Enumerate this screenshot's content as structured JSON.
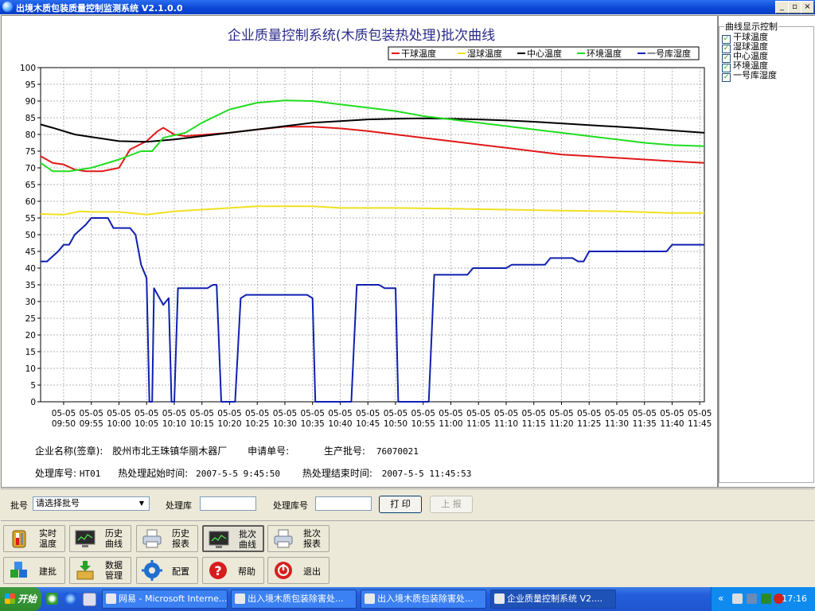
{
  "window": {
    "title": "出境木质包装质量控制监测系统 V2.1.0.0",
    "buttons": [
      "_",
      "▫",
      "×"
    ]
  },
  "chart_data": {
    "type": "line",
    "title": "企业质量控制系统(木质包装热处理)批次曲线",
    "ylim": [
      0,
      100
    ],
    "yticks": [
      0,
      5,
      10,
      15,
      20,
      25,
      30,
      35,
      40,
      45,
      50,
      55,
      60,
      65,
      70,
      75,
      80,
      85,
      90,
      95,
      100
    ],
    "xticks": [
      {
        "date": "05-05",
        "time": "09:50"
      },
      {
        "date": "05-05",
        "time": "09:55"
      },
      {
        "date": "05-05",
        "time": "10:00"
      },
      {
        "date": "05-05",
        "time": "10:05"
      },
      {
        "date": "05-05",
        "time": "10:10"
      },
      {
        "date": "05-05",
        "time": "10:15"
      },
      {
        "date": "05-05",
        "time": "10:20"
      },
      {
        "date": "05-05",
        "time": "10:25"
      },
      {
        "date": "05-05",
        "time": "10:30"
      },
      {
        "date": "05-05",
        "time": "10:35"
      },
      {
        "date": "05-05",
        "time": "10:40"
      },
      {
        "date": "05-05",
        "time": "10:45"
      },
      {
        "date": "05-05",
        "time": "10:50"
      },
      {
        "date": "05-05",
        "time": "10:55"
      },
      {
        "date": "05-05",
        "time": "11:00"
      },
      {
        "date": "05-05",
        "time": "11:05"
      },
      {
        "date": "05-05",
        "time": "11:10"
      },
      {
        "date": "05-05",
        "time": "11:15"
      },
      {
        "date": "05-05",
        "time": "11:20"
      },
      {
        "date": "05-05",
        "time": "11:25"
      },
      {
        "date": "05-05",
        "time": "11:30"
      },
      {
        "date": "05-05",
        "time": "11:35"
      },
      {
        "date": "05-05",
        "time": "11:40"
      },
      {
        "date": "05-05",
        "time": "11:45"
      }
    ],
    "x_range": [
      "09:45:50",
      "11:45:50"
    ],
    "grid": true,
    "legend_position": "top-right",
    "series": [
      {
        "name": "干球温度",
        "color": "#e01818",
        "points": [
          [
            "09:45:50",
            73.5
          ],
          [
            "09:48",
            71.5
          ],
          [
            "09:50",
            71
          ],
          [
            "09:52",
            69.5
          ],
          [
            "09:54",
            69
          ],
          [
            "09:57",
            69
          ],
          [
            "10:00",
            70
          ],
          [
            "10:02",
            75.5
          ],
          [
            "10:05",
            78
          ],
          [
            "10:07",
            81
          ],
          [
            "10:08",
            82
          ],
          [
            "10:10",
            80
          ],
          [
            "10:12",
            79.5
          ],
          [
            "10:20",
            80.5
          ],
          [
            "10:25",
            81.5
          ],
          [
            "10:30",
            82.3
          ],
          [
            "10:35",
            82.3
          ],
          [
            "10:40",
            81.8
          ],
          [
            "10:45",
            81
          ],
          [
            "10:50",
            80
          ],
          [
            "10:55",
            79
          ],
          [
            "11:00",
            78
          ],
          [
            "11:05",
            77
          ],
          [
            "11:10",
            76
          ],
          [
            "11:15",
            75
          ],
          [
            "11:20",
            74
          ],
          [
            "11:25",
            73.5
          ],
          [
            "11:30",
            73
          ],
          [
            "11:35",
            72.5
          ],
          [
            "11:40",
            72
          ],
          [
            "11:45:50",
            71.5
          ]
        ]
      },
      {
        "name": "湿球温度",
        "color": "#f0e020",
        "points": [
          [
            "09:45:50",
            56.2
          ],
          [
            "09:50",
            56
          ],
          [
            "09:53",
            57
          ],
          [
            "09:55",
            56.8
          ],
          [
            "10:00",
            56.8
          ],
          [
            "10:05",
            56
          ],
          [
            "10:10",
            57
          ],
          [
            "10:15",
            57.5
          ],
          [
            "10:20",
            58
          ],
          [
            "10:25",
            58.5
          ],
          [
            "10:30",
            58.5
          ],
          [
            "10:35",
            58.5
          ],
          [
            "10:40",
            58
          ],
          [
            "10:50",
            58
          ],
          [
            "11:00",
            57.8
          ],
          [
            "11:10",
            57.5
          ],
          [
            "11:20",
            57.2
          ],
          [
            "11:30",
            57
          ],
          [
            "11:40",
            56.5
          ],
          [
            "11:45:50",
            56.5
          ]
        ]
      },
      {
        "name": "中心温度",
        "color": "#000000",
        "points": [
          [
            "09:45:50",
            83
          ],
          [
            "09:48",
            82
          ],
          [
            "09:52",
            80
          ],
          [
            "09:56",
            79
          ],
          [
            "10:00",
            78
          ],
          [
            "10:05",
            77.8
          ],
          [
            "10:10",
            78.5
          ],
          [
            "10:15",
            79.5
          ],
          [
            "10:20",
            80.5
          ],
          [
            "10:25",
            81.5
          ],
          [
            "10:30",
            82.5
          ],
          [
            "10:35",
            83.5
          ],
          [
            "10:40",
            84
          ],
          [
            "10:45",
            84.5
          ],
          [
            "10:50",
            84.7
          ],
          [
            "10:55",
            84.8
          ],
          [
            "11:00",
            84.7
          ],
          [
            "11:05",
            84.5
          ],
          [
            "11:10",
            84.2
          ],
          [
            "11:15",
            83.8
          ],
          [
            "11:20",
            83.3
          ],
          [
            "11:25",
            82.8
          ],
          [
            "11:30",
            82.3
          ],
          [
            "11:35",
            81.8
          ],
          [
            "11:40",
            81.2
          ],
          [
            "11:45:50",
            80.5
          ]
        ]
      },
      {
        "name": "环境温度",
        "color": "#20dd20",
        "points": [
          [
            "09:45:50",
            71.5
          ],
          [
            "09:48",
            69
          ],
          [
            "09:51",
            69
          ],
          [
            "09:55",
            70
          ],
          [
            "10:00",
            72.5
          ],
          [
            "10:04",
            75
          ],
          [
            "10:06",
            75
          ],
          [
            "10:08",
            79
          ],
          [
            "10:12",
            80.5
          ],
          [
            "10:15",
            83.5
          ],
          [
            "10:20",
            87.5
          ],
          [
            "10:25",
            89.5
          ],
          [
            "10:30",
            90.2
          ],
          [
            "10:35",
            90
          ],
          [
            "10:40",
            89
          ],
          [
            "10:45",
            88
          ],
          [
            "10:50",
            87
          ],
          [
            "10:55",
            85.5
          ],
          [
            "11:00",
            84.5
          ],
          [
            "11:05",
            83.5
          ],
          [
            "11:10",
            82.5
          ],
          [
            "11:15",
            81.5
          ],
          [
            "11:20",
            80.5
          ],
          [
            "11:25",
            79.5
          ],
          [
            "11:30",
            78.5
          ],
          [
            "11:35",
            77.5
          ],
          [
            "11:40",
            76.8
          ],
          [
            "11:45:50",
            76.5
          ]
        ]
      },
      {
        "name": "一号库湿度",
        "color": "#1020b0",
        "points": [
          [
            "09:45:50",
            42
          ],
          [
            "09:47",
            42
          ],
          [
            "09:49",
            45
          ],
          [
            "09:50",
            47
          ],
          [
            "09:51",
            47
          ],
          [
            "09:52",
            50
          ],
          [
            "09:54",
            53
          ],
          [
            "09:55",
            55
          ],
          [
            "09:58",
            55
          ],
          [
            "09:59",
            52
          ],
          [
            "10:02",
            52
          ],
          [
            "10:03",
            50
          ],
          [
            "10:04",
            41
          ],
          [
            "10:05",
            37
          ],
          [
            "10:05:30",
            0
          ],
          [
            "10:06",
            0
          ],
          [
            "10:06:20",
            34
          ],
          [
            "10:07",
            32
          ],
          [
            "10:08",
            29
          ],
          [
            "10:09",
            31
          ],
          [
            "10:09:30",
            0
          ],
          [
            "10:10",
            0
          ],
          [
            "10:10:40",
            34
          ],
          [
            "10:16",
            34
          ],
          [
            "10:17",
            35
          ],
          [
            "10:17:40",
            35
          ],
          [
            "10:18:30",
            0
          ],
          [
            "10:21",
            0
          ],
          [
            "10:22",
            31
          ],
          [
            "10:23",
            32
          ],
          [
            "10:34",
            32
          ],
          [
            "10:35",
            31
          ],
          [
            "10:35:30",
            0
          ],
          [
            "10:42",
            0
          ],
          [
            "10:43",
            35
          ],
          [
            "10:47",
            35
          ],
          [
            "10:48",
            34
          ],
          [
            "10:50",
            34
          ],
          [
            "10:50:30",
            0
          ],
          [
            "10:56",
            0
          ],
          [
            "10:57",
            38
          ],
          [
            "11:03",
            38
          ],
          [
            "11:04",
            40
          ],
          [
            "11:10",
            40
          ],
          [
            "11:11",
            41
          ],
          [
            "11:17",
            41
          ],
          [
            "11:18",
            43
          ],
          [
            "11:22",
            43
          ],
          [
            "11:23",
            42
          ],
          [
            "11:24",
            42
          ],
          [
            "11:25",
            45
          ],
          [
            "11:34",
            45
          ],
          [
            "11:35",
            45
          ],
          [
            "11:39",
            45
          ],
          [
            "11:40",
            47
          ],
          [
            "11:45:50",
            47
          ]
        ]
      }
    ]
  },
  "info": {
    "company_label": "企业名称(签章):",
    "company_value": "胶州市北王珠镇华丽木器厂",
    "apply_label": "申请单号:",
    "apply_value": "",
    "batch_label": "生产批号:",
    "batch_value": "76070021",
    "store_label": "处理库号:",
    "store_value": "HT01",
    "start_label": "热处理起始时间:",
    "start_value": "2007-5-5 9:45:50",
    "end_label": "热处理结束时间:",
    "end_value": "2007-5-5 11:45:53"
  },
  "legend_control": {
    "title": "曲线显示控制",
    "items": [
      {
        "label": "干球温度",
        "checked": true
      },
      {
        "label": "湿球温度",
        "checked": true
      },
      {
        "label": "中心温度",
        "checked": true
      },
      {
        "label": "环境温度",
        "checked": true
      },
      {
        "label": "一号库湿度",
        "checked": true
      }
    ]
  },
  "controls": {
    "batch_label": "批号",
    "batch_select": "请选择批号",
    "store_label": "处理库",
    "store_value": "",
    "store_no_label": "处理库号",
    "store_no_value": "",
    "print_label": "打 印",
    "upload_label": "上 报"
  },
  "toolbar": {
    "row1": [
      {
        "label1": "实时",
        "label2": "温度"
      },
      {
        "label1": "历史",
        "label2": "曲线"
      },
      {
        "label1": "历史",
        "label2": "报表"
      },
      {
        "label1": "批次",
        "label2": "曲线"
      },
      {
        "label1": "批次",
        "label2": "报表"
      }
    ],
    "row2": [
      {
        "label": "建批"
      },
      {
        "label1": "数据",
        "label2": "管理"
      },
      {
        "label": "配置"
      },
      {
        "label": "帮助"
      },
      {
        "label": "退出"
      }
    ]
  },
  "taskbar": {
    "start": "开始",
    "tasks": [
      "网易 - Microsoft Interne...",
      "出入境木质包装除害处...",
      "出入境木质包装除害处...",
      "企业质量控制系统 V2...."
    ],
    "clock": "17:16",
    "tray_arrow": "«"
  }
}
